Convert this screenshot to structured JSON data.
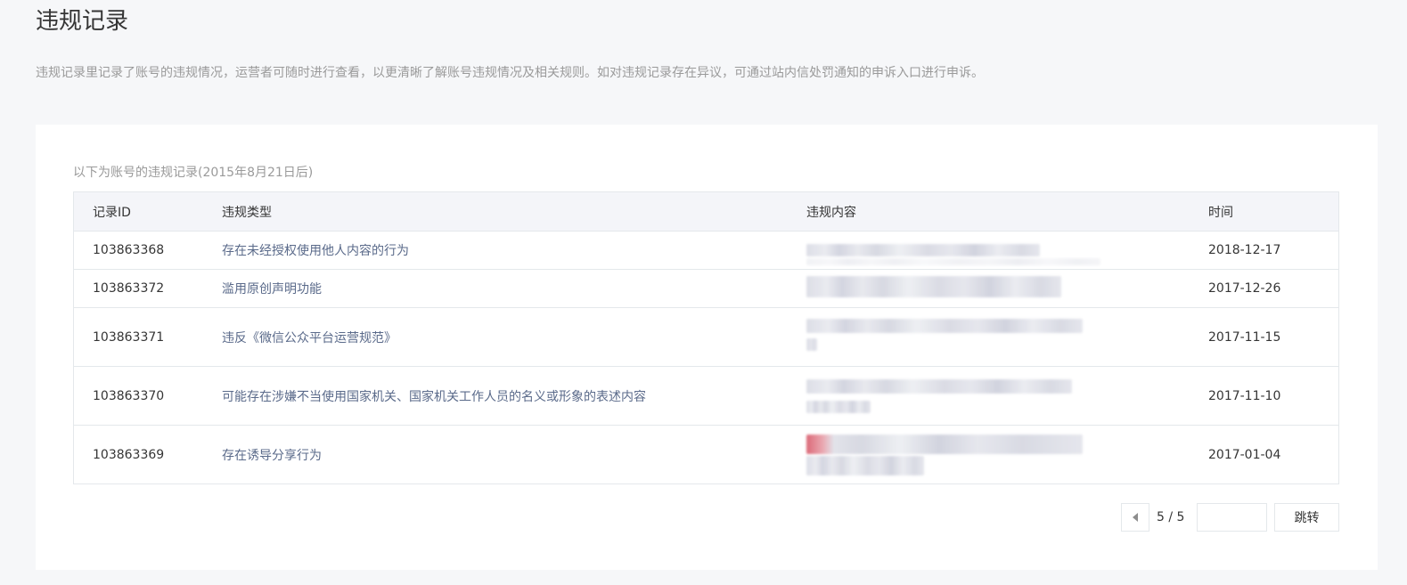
{
  "page": {
    "title": "违规记录",
    "description": "违规记录里记录了账号的违规情况，运营者可随时进行查看，以更清晰了解账号违规情况及相关规则。如对违规记录存在异议，可通过站内信处罚通知的申诉入口进行申诉。"
  },
  "table": {
    "caption": "以下为账号的违规记录(2015年8月21日后)",
    "headers": {
      "id": "记录ID",
      "type": "违规类型",
      "content": "违规内容",
      "time": "时间"
    },
    "rows": [
      {
        "id": "103863368",
        "type": "存在未经授权使用他人内容的行为",
        "content": "",
        "time": "2018-12-17"
      },
      {
        "id": "103863372",
        "type": "滥用原创声明功能",
        "content": "",
        "time": "2017-12-26"
      },
      {
        "id": "103863371",
        "type": "违反《微信公众平台运营规范》",
        "content": "",
        "time": "2017-11-15"
      },
      {
        "id": "103863370",
        "type": "可能存在涉嫌不当使用国家机关、国家机关工作人员的名义或形象的表述内容",
        "content": "",
        "time": "2017-11-10"
      },
      {
        "id": "103863369",
        "type": "存在诱导分享行为",
        "content": "",
        "time": "2017-01-04"
      }
    ]
  },
  "pager": {
    "count": "5 / 5",
    "input_value": "",
    "jump_label": "跳转",
    "prev_icon": "triangle-left-icon"
  },
  "colors": {
    "page_background": "#f6f7f9",
    "card_background": "#ffffff",
    "border": "#e4e8eb",
    "header_background": "#f4f5f9",
    "type_text": "#5a6a8a",
    "muted_text": "#9a9a9a"
  }
}
